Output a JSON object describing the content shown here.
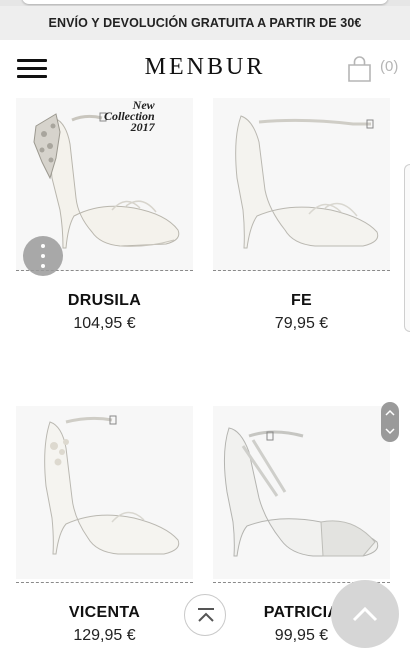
{
  "promo": {
    "text": "ENVÍO Y DEVOLUCIÓN GRATUITA A PARTIR DE 30€"
  },
  "header": {
    "logo": "MENBUR",
    "cart_count": "(0)"
  },
  "badge": {
    "line1": "New",
    "line2": "Collection",
    "line3": "2017"
  },
  "products": [
    {
      "name": "DRUSILA",
      "price": "104,95 €"
    },
    {
      "name": "FE",
      "price": "79,95 €"
    },
    {
      "name": "VICENTA",
      "price": "129,95 €"
    },
    {
      "name": "PATRICIA",
      "price": "99,95 €"
    }
  ],
  "icons": {
    "menu": "hamburger-menu-icon",
    "cart": "shopping-bag-icon",
    "more": "more-vertical-icon",
    "back_to_top": "back-to-top-icon",
    "scroll_up": "chevron-up-icon"
  },
  "colors": {
    "promo_bg": "#eeeeee",
    "text": "#111111",
    "muted": "#b5b5b5"
  }
}
